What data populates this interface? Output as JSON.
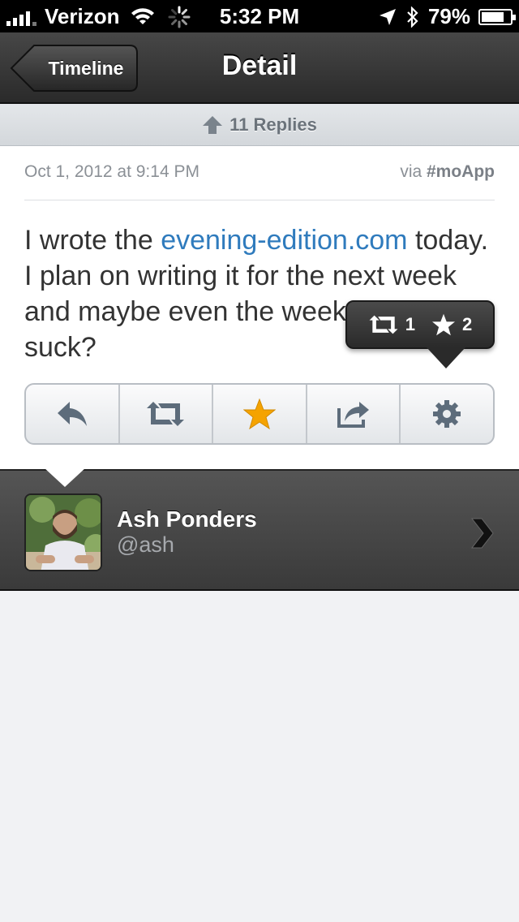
{
  "status_bar": {
    "carrier": "Verizon",
    "time": "5:32 PM",
    "battery": "79%",
    "battery_level": 0.79,
    "icons": [
      "signal-icon",
      "wifi-icon",
      "activity-spinner-icon",
      "location-icon",
      "bluetooth-icon",
      "battery-icon"
    ]
  },
  "navbar": {
    "back_label": "Timeline",
    "title": "Detail"
  },
  "replies": {
    "label": "11 Replies",
    "icon": "up-arrow-icon"
  },
  "tweet": {
    "date": "Oct 1, 2012 at 9:14 PM",
    "via_prefix": "via ",
    "via_app": "#moApp",
    "text_before": "I wrote the ",
    "link_text": "evening-edition.com",
    "text_after": " today. I plan on writing it for the next week and maybe even the week after. Did it suck?",
    "link_color": "#2f7bbd"
  },
  "popover": {
    "retweets": "1",
    "favorites": "2"
  },
  "toolbar": {
    "buttons": [
      "reply-icon",
      "retweet-icon",
      "favorite-star-icon",
      "share-icon",
      "settings-gear-icon"
    ],
    "favorite_color": "#f5a300"
  },
  "user": {
    "name": "Ash Ponders",
    "handle": "@ash"
  }
}
